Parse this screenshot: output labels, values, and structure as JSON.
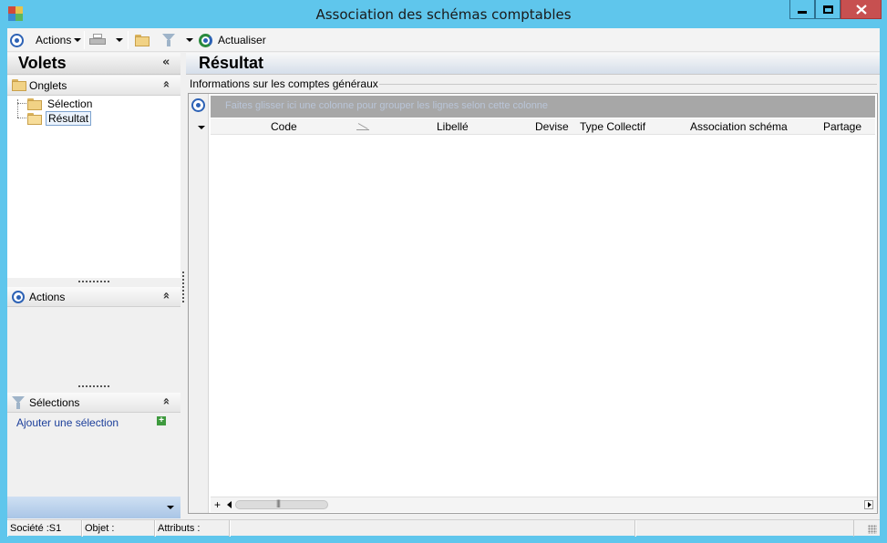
{
  "window": {
    "title": "Association des schémas comptables"
  },
  "toolbar": {
    "actions_label": "Actions",
    "refresh_label": "Actualiser"
  },
  "left": {
    "title": "Volets",
    "onglets": {
      "title": "Onglets",
      "items": [
        {
          "label": "Sélection"
        },
        {
          "label": "Résultat"
        }
      ]
    },
    "actions": {
      "title": "Actions"
    },
    "selections": {
      "title": "Sélections",
      "add_link": "Ajouter une sélection"
    }
  },
  "right": {
    "title": "Résultat",
    "group_label": "Informations sur les comptes généraux",
    "group_hint": "Faites glisser ici une colonne pour grouper les lignes selon cette colonne",
    "columns": [
      {
        "label": "Code"
      },
      {
        "label": "Libellé"
      },
      {
        "label": "Devise"
      },
      {
        "label": "Type Collectif"
      },
      {
        "label": "Association schéma"
      },
      {
        "label": "Partage"
      }
    ],
    "scroll_plus": "+"
  },
  "status": {
    "societe": "Société :S1",
    "objet": "Objet :",
    "attributs": "Attributs :"
  },
  "colors": {
    "titlebar": "#5fc6ec",
    "close_button": "#c75050",
    "accent_blue": "#2d62b5",
    "group_panel": "#a7a7a7"
  }
}
